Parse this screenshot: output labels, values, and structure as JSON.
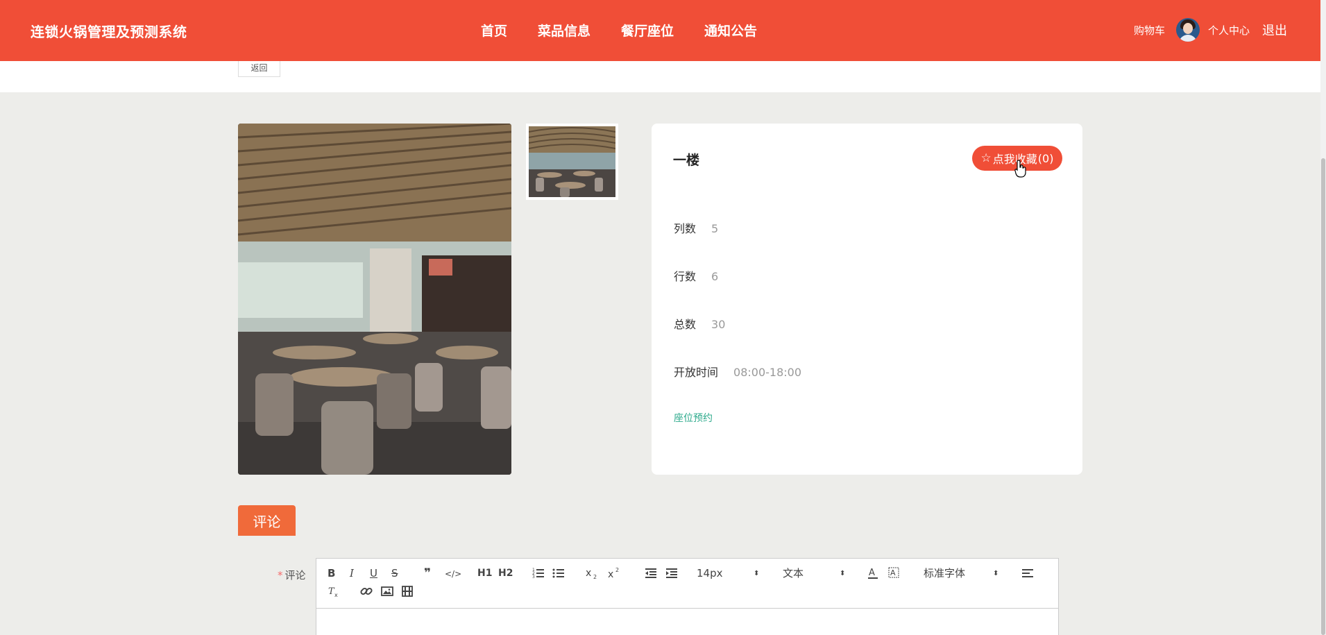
{
  "header": {
    "logo": "连锁火锅管理及预测系统",
    "nav": [
      "首页",
      "菜品信息",
      "餐厅座位",
      "通知公告"
    ],
    "cart": "购物车",
    "profile": "个人中心",
    "logout": "退出",
    "brand_color": "#f04e37"
  },
  "back_button": "返回",
  "detail": {
    "title": "一楼",
    "favorite_label": "点我收藏",
    "favorite_count": "(0)",
    "fields": [
      {
        "label": "列数",
        "value": "5"
      },
      {
        "label": "行数",
        "value": "6"
      },
      {
        "label": "总数",
        "value": "30"
      },
      {
        "label": "开放时间",
        "value": "08:00-18:00"
      }
    ],
    "reserve_link": "座位预约"
  },
  "comment": {
    "tab": "评论",
    "field_label": "评论",
    "required_mark": "*",
    "toolbar": {
      "bold": "B",
      "italic": "I",
      "underline": "U",
      "strike": "S",
      "quote": "❞",
      "code": "</>",
      "h1": "H1",
      "h2": "H2",
      "font_size": "14px",
      "text_type": "文本",
      "font_family": "标准字体"
    }
  }
}
